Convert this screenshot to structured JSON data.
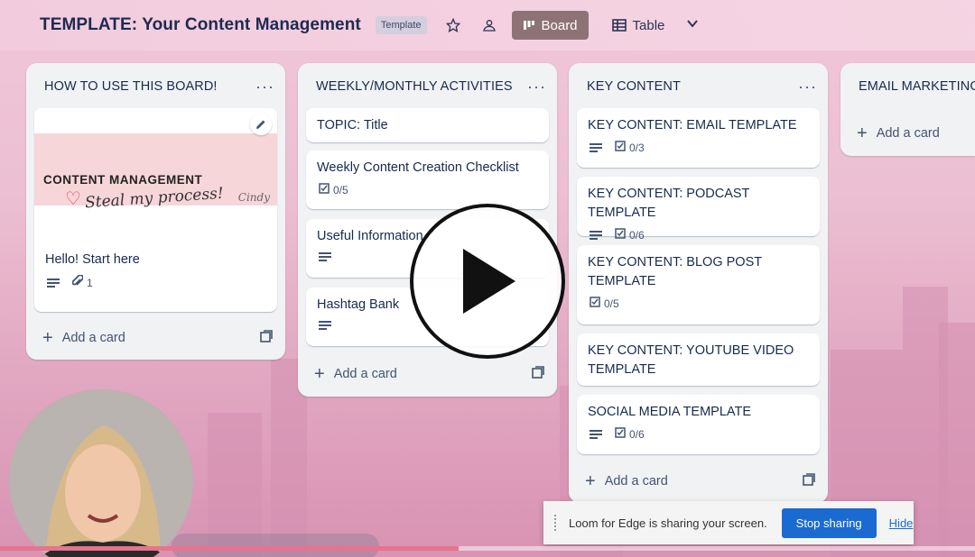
{
  "header": {
    "title": "TEMPLATE: Your Content Management",
    "badge": "Template",
    "views": [
      {
        "label": "Board",
        "active": true
      },
      {
        "label": "Table",
        "active": false
      }
    ]
  },
  "lists": [
    {
      "title": "HOW TO USE THIS BOARD!",
      "cover": {
        "heading": "CONTENT MANAGEMENT",
        "script": "Steal my process!",
        "signature": "Cindy"
      },
      "cards": [
        {
          "title": "Hello! Start here",
          "description": true,
          "attachments": "1"
        }
      ],
      "add_label": "Add a card"
    },
    {
      "title": "WEEKLY/MONTHLY ACTIVITIES",
      "cards": [
        {
          "title": "TOPIC: Title"
        },
        {
          "title": "Weekly Content Creation Checklist",
          "checklist": "0/5"
        },
        {
          "title": "Useful Information",
          "description": true
        },
        {
          "title": "Hashtag Bank",
          "description": true
        }
      ],
      "add_label": "Add a card"
    },
    {
      "title": "KEY CONTENT",
      "cards": [
        {
          "title": "KEY CONTENT: EMAIL TEMPLATE",
          "description": true,
          "checklist": "0/3"
        },
        {
          "title": "KEY CONTENT: PODCAST TEMPLATE",
          "description": true,
          "checklist": "0/6"
        },
        {
          "title": "KEY CONTENT: BLOG POST TEMPLATE",
          "checklist": "0/5"
        },
        {
          "title": "KEY CONTENT: YOUTUBE VIDEO TEMPLATE"
        },
        {
          "title": "SOCIAL MEDIA TEMPLATE",
          "description": true,
          "checklist": "0/6"
        }
      ],
      "add_label": "Add a card"
    },
    {
      "title": "EMAIL MARKETING",
      "cards": [],
      "add_label": "Add a card"
    }
  ],
  "loom": {
    "message": "Loom for Edge is sharing your screen.",
    "stop_label": "Stop sharing",
    "hide_label": "Hide"
  },
  "video": {
    "progress": 0.47
  }
}
